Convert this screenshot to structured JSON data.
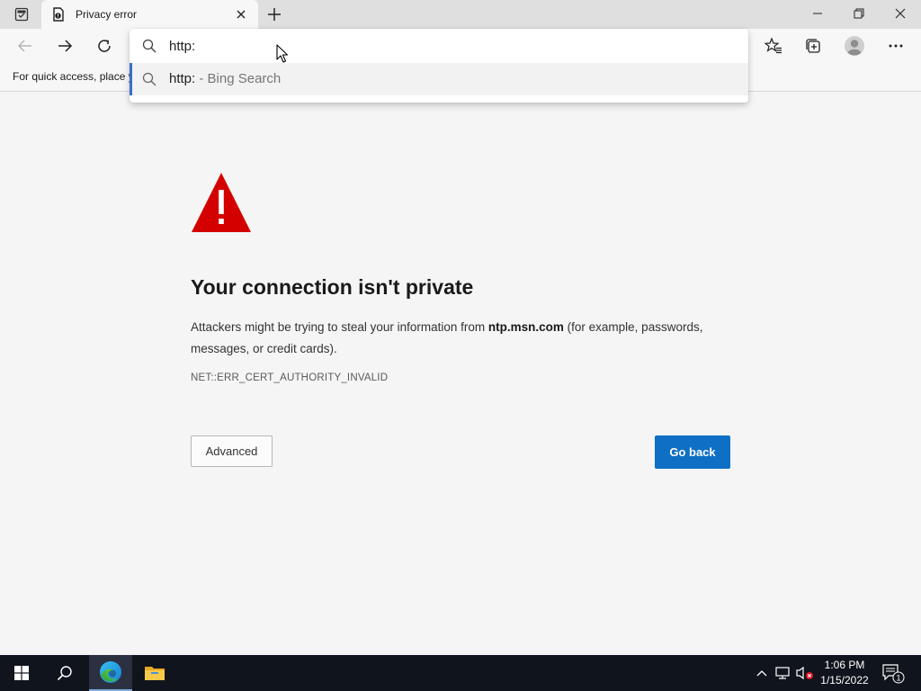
{
  "browser": {
    "tab": {
      "title": "Privacy error"
    },
    "favorites_bar": {
      "text": "For quick access, place y"
    },
    "omnibox": {
      "value": "http:",
      "suggestion": {
        "query": "http:",
        "separator": " - ",
        "provider": "Bing Search"
      }
    }
  },
  "page": {
    "heading": "Your connection isn't private",
    "description": {
      "prefix": "Attackers might be trying to steal your information from ",
      "domain": "ntp.msn.com",
      "suffix": " (for example, passwords, messages, or credit cards)."
    },
    "error_code": "NET::ERR_CERT_AUTHORITY_INVALID",
    "advanced_button": "Advanced",
    "go_back_button": "Go back"
  },
  "taskbar": {
    "time": "1:06 PM",
    "date": "1/15/2022",
    "notification_count": "1"
  },
  "colors": {
    "warning_red": "#d40000",
    "primary_button": "#0e6fc4",
    "taskbar_bg": "#10141c",
    "suggestion_accent": "#3a6fc4"
  },
  "icons": {
    "tab_actions": "tab-actions-icon",
    "favicon": "privacy-error-icon",
    "back": "back-arrow-icon",
    "forward": "forward-arrow-icon",
    "refresh": "refresh-icon",
    "search": "search-icon",
    "favorites": "favorites-icon",
    "collections": "collections-icon",
    "profile": "profile-icon",
    "menu": "more-menu-icon",
    "warning": "warning-triangle-icon"
  }
}
